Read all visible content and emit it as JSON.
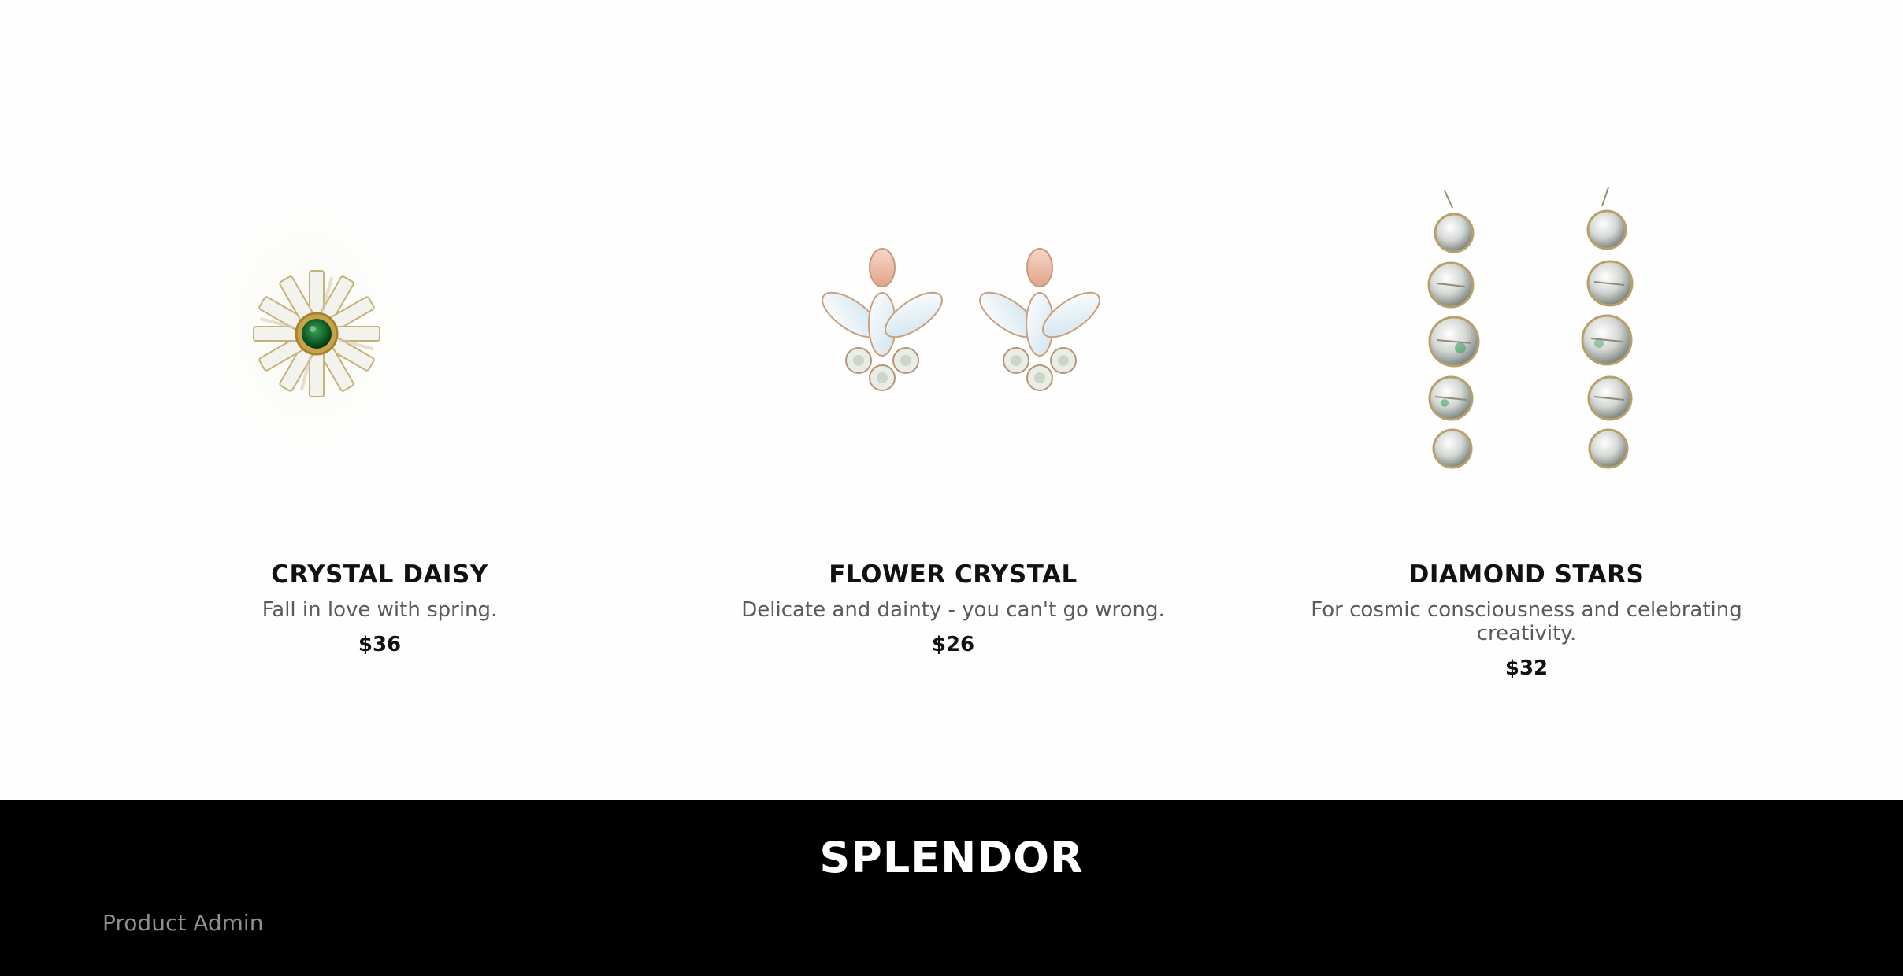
{
  "products": [
    {
      "title": "CRYSTAL DAISY",
      "description": "Fall in love with spring.",
      "price": "$36",
      "image": "crystal-daisy-earring-photo"
    },
    {
      "title": "FLOWER CRYSTAL",
      "description": "Delicate and dainty - you can't go wrong.",
      "price": "$26",
      "image": "flower-crystal-earrings-photo"
    },
    {
      "title": "DIAMOND STARS",
      "description": "For cosmic consciousness and celebrating creativity.",
      "price": "$32",
      "image": "diamond-stars-earrings-photo"
    }
  ],
  "footer": {
    "brand": "SPLENDOR",
    "admin_link": "Product Admin"
  },
  "colors": {
    "footer_background": "#000000",
    "title_text": "#111111",
    "description_text": "#5a5a5a",
    "admin_link_text": "#8f8f8f"
  }
}
